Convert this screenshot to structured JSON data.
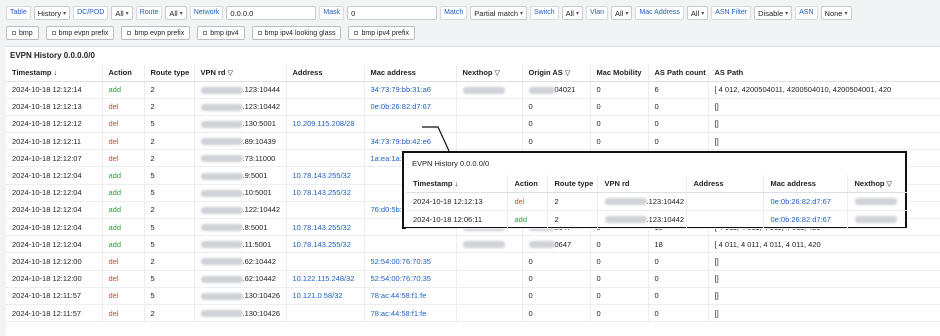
{
  "filters": [
    {
      "label": "Table",
      "value": "History",
      "kind": "select"
    },
    {
      "label": "DC/POD",
      "value": "All",
      "kind": "select"
    },
    {
      "label": "Route",
      "value": "All",
      "kind": "select"
    },
    {
      "label": "Network",
      "value": "0.0.0.0",
      "kind": "input"
    },
    {
      "label": "Mask",
      "value": "0",
      "kind": "input"
    },
    {
      "label": "Match",
      "value": "Partial match",
      "kind": "select"
    },
    {
      "label": "Switch",
      "value": "All",
      "kind": "select"
    },
    {
      "label": "Vlan",
      "value": "All",
      "kind": "select"
    },
    {
      "label": "Mac Address",
      "value": "All",
      "kind": "select"
    },
    {
      "label": "ASN Filter",
      "value": "Disable",
      "kind": "select"
    },
    {
      "label": "ASN",
      "value": "None",
      "kind": "select"
    }
  ],
  "chips": [
    "bmp",
    "bmp evpn prefix",
    "bmp evpn prefix",
    "bmp ipv4",
    "bmp ipv4 looking glass",
    "bmp ipv4 prefix"
  ],
  "panel": {
    "title": "EVPN History 0.0.0.0/0",
    "columns": [
      "Timestamp ↓",
      "Action",
      "Route type",
      "VPN rd",
      "Address",
      "Mac address",
      "Nexthop",
      "Origin AS",
      "Mac Mobility",
      "AS Path count",
      "AS Path"
    ],
    "rows": [
      {
        "ts": "2024-10-18 12:12:14",
        "action": "add",
        "rt": "2",
        "rd": ".123:10444",
        "addr": "",
        "mac": "34:73:79:bb:31:a6",
        "nh": true,
        "oas": "04021",
        "mm": "0",
        "apc": "6",
        "ap": "[ 4        012, 4200504011, 4200504010, 4200504001, 420"
      },
      {
        "ts": "2024-10-18 12:12:13",
        "action": "del",
        "rt": "2",
        "rd": ".123:10442",
        "addr": "",
        "mac": "0e:0b:26:82:d7:67",
        "nh": false,
        "oas": "0",
        "mm": "0",
        "apc": "0",
        "ap": "[]"
      },
      {
        "ts": "2024-10-18 12:12:12",
        "action": "del",
        "rt": "5",
        "rd": ".130:5001",
        "addr": "10.209.115.208/28",
        "mac": "",
        "nh": false,
        "oas": "0",
        "mm": "0",
        "apc": "0",
        "ap": "[]"
      },
      {
        "ts": "2024-10-18 12:12:11",
        "action": "del",
        "rt": "2",
        "rd": ".89:10439",
        "addr": "",
        "mac": "34:73:79:bb:42:e6",
        "nh": false,
        "oas": "0",
        "mm": "0",
        "apc": "0",
        "ap": "[]"
      },
      {
        "ts": "2024-10-18 12:12:07",
        "action": "del",
        "rt": "2",
        "rd": ".73:11000",
        "addr": "",
        "mac": "1a:ea:1a:cd",
        "nh": false,
        "oas": "",
        "mm": "",
        "apc": "",
        "ap": ""
      },
      {
        "ts": "2024-10-18 12:12:04",
        "action": "add",
        "rt": "5",
        "rd": ".9:5001",
        "addr": "10.78.143.255/32",
        "mac": "",
        "nh": false,
        "oas": "",
        "mm": "",
        "apc": "",
        "ap": "["
      },
      {
        "ts": "2024-10-18 12:12:04",
        "action": "add",
        "rt": "5",
        "rd": ".10:5001",
        "addr": "10.78.143.255/32",
        "mac": "",
        "nh": false,
        "oas": "",
        "mm": "",
        "apc": "",
        "ap": "["
      },
      {
        "ts": "2024-10-18 12:12:04",
        "action": "add",
        "rt": "2",
        "rd": ".122:10442",
        "addr": "",
        "mac": "76:d0:5b:9",
        "nh": false,
        "oas": "",
        "mm": "",
        "apc": "",
        "ap": "["
      },
      {
        "ts": "2024-10-18 12:12:04",
        "action": "add",
        "rt": "5",
        "rd": ".8:5001",
        "addr": "10.78.143.255/32",
        "mac": "",
        "nh": true,
        "oas": "0647",
        "mm": "0",
        "apc": "18",
        "ap": "[ 4        011, 4        011, 4        011, 4        011, 420"
      },
      {
        "ts": "2024-10-18 12:12:04",
        "action": "add",
        "rt": "5",
        "rd": ".11:5001",
        "addr": "10.78.143.255/32",
        "mac": "",
        "nh": true,
        "oas": "0647",
        "mm": "0",
        "apc": "18",
        "ap": "[ 4        011, 4        011, 4        011, 4        011, 420"
      },
      {
        "ts": "2024-10-18 12:12:00",
        "action": "del",
        "rt": "2",
        "rd": ".62:10442",
        "addr": "",
        "mac": "52:54:00:76:70:35",
        "nh": false,
        "oas": "0",
        "mm": "0",
        "apc": "0",
        "ap": "[]"
      },
      {
        "ts": "2024-10-18 12:12:00",
        "action": "del",
        "rt": "5",
        "rd": ".62:10442",
        "addr": "10.122.115.248/32",
        "mac": "52:54:00:76:70:35",
        "nh": false,
        "oas": "0",
        "mm": "0",
        "apc": "0",
        "ap": "[]"
      },
      {
        "ts": "2024-10-18 12:11:57",
        "action": "del",
        "rt": "5",
        "rd": ".130:10426",
        "addr": "10.121.0.58/32",
        "mac": "78:ac:44:58:f1:fe",
        "nh": false,
        "oas": "0",
        "mm": "0",
        "apc": "0",
        "ap": "[]"
      },
      {
        "ts": "2024-10-18 12:11:57",
        "action": "del",
        "rt": "2",
        "rd": ".130:10426",
        "addr": "",
        "mac": "78:ac:44:58:f1:fe",
        "nh": false,
        "oas": "0",
        "mm": "0",
        "apc": "0",
        "ap": "[]"
      }
    ]
  },
  "zoom": {
    "title": "EVPN History 0.0.0.0/0",
    "columns": [
      "Timestamp ↓",
      "Action",
      "Route type",
      "VPN rd",
      "Address",
      "Mac address",
      "Nexthop"
    ],
    "rows": [
      {
        "ts": "2024-10-18 12:12:13",
        "action": "del",
        "rt": "2",
        "rd": ".123:10442",
        "addr": "",
        "mac": "0e:0b:26:82:d7:67"
      },
      {
        "ts": "2024-10-18 12:06:11",
        "action": "add",
        "rt": "2",
        "rd": ".123:10442",
        "addr": "",
        "mac": "0e:0b:26:82:d7:67"
      }
    ]
  }
}
